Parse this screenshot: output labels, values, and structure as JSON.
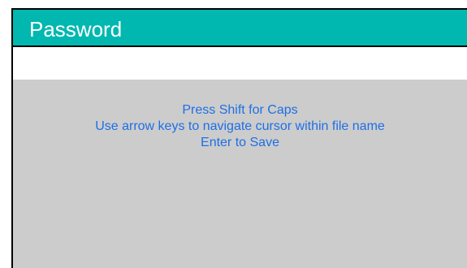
{
  "dialog": {
    "title": "Password",
    "input_value": ""
  },
  "hints": [
    "Press Shift for Caps",
    "Use arrow keys to navigate cursor within file name",
    "Enter to Save"
  ],
  "colors": {
    "titlebar": "#00b8b0",
    "title_text": "#ffffff",
    "hint_text": "#1e6fe6",
    "panel": "#cccccc",
    "input_bg": "#ffffff",
    "border": "#000000"
  }
}
